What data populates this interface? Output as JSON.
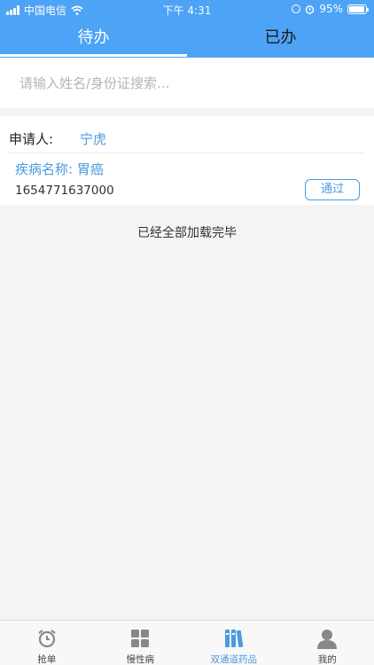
{
  "status_bar": {
    "carrier": "中国电信",
    "time": "下午 4:31",
    "battery_percent": "95%",
    "battery_level": 0.95
  },
  "tabs": [
    {
      "label": "待办",
      "active": true
    },
    {
      "label": "已办",
      "active": false
    }
  ],
  "search": {
    "placeholder": "请输入姓名/身份证搜索...",
    "value": ""
  },
  "record": {
    "applicant_label": "申请人:",
    "applicant_name": "宁虎",
    "disease_label": "疾病名称: ",
    "disease_name": "胃癌",
    "id_number": "1654771637000",
    "action_label": "通过"
  },
  "list_status": "已经全部加载完毕",
  "bottom_nav": [
    {
      "label": "抢单",
      "icon": "alarm-clock-icon",
      "active": false
    },
    {
      "label": "慢性病",
      "icon": "grid-icon",
      "active": false
    },
    {
      "label": "双通道药品",
      "icon": "books-icon",
      "active": true
    },
    {
      "label": "我的",
      "icon": "person-icon",
      "active": false
    }
  ],
  "colors": {
    "accent": "#4da3f5",
    "link": "#4a9be0",
    "background": "#f4f4f4"
  }
}
